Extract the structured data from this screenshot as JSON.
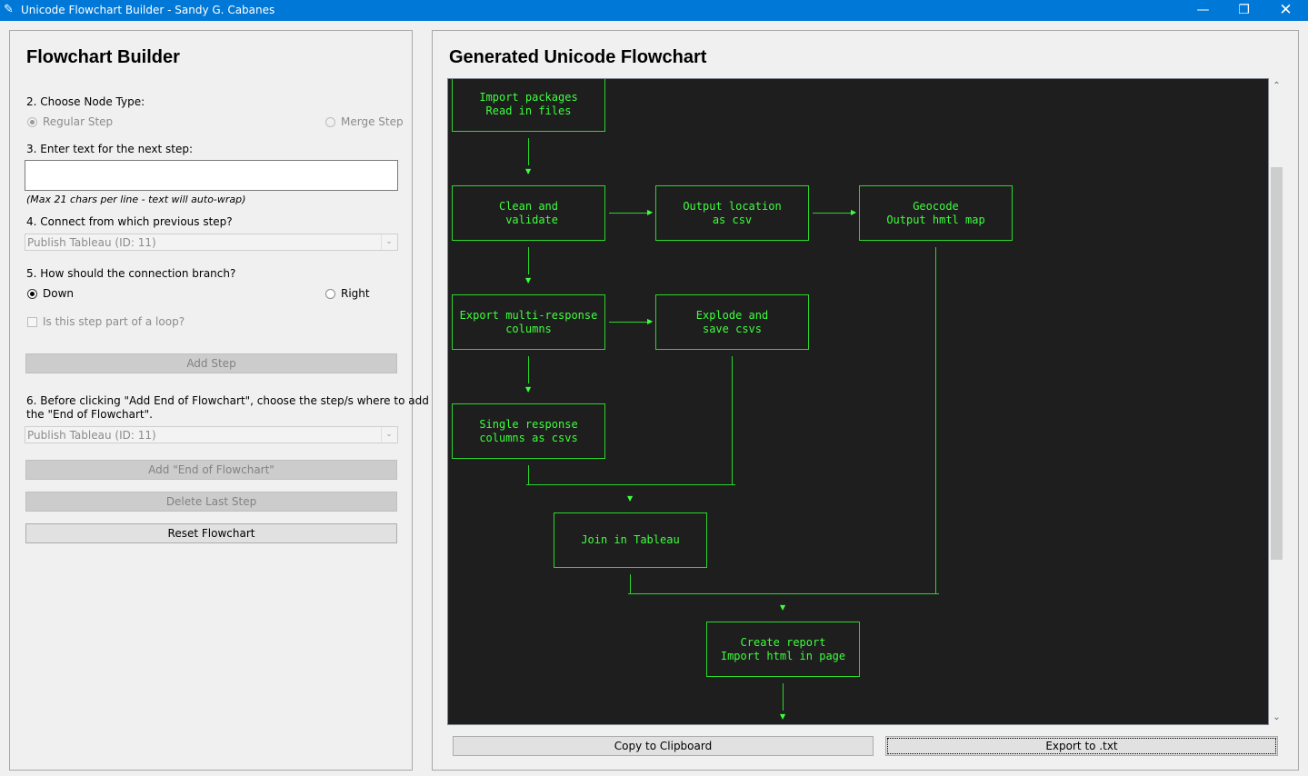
{
  "window": {
    "title": "Unicode Flowchart Builder - Sandy G. Cabanes"
  },
  "left": {
    "heading": "Flowchart Builder",
    "step2_label": "2. Choose Node Type:",
    "regular_label": "Regular Step",
    "merge_label": "Merge Step",
    "step3_label": "3. Enter text for the next step:",
    "text_value": "",
    "hint": "(Max 21 chars per line - text will auto-wrap)",
    "step4_label": "4. Connect from which previous step?",
    "connect_value": "Publish Tableau (ID: 11)",
    "step5_label": "5. How should the connection branch?",
    "down_label": "Down",
    "right_label": "Right",
    "loop_label": "Is this step part of a loop?",
    "add_step": "Add Step",
    "step6_label_line1": "6. Before clicking \"Add End of Flowchart\", choose the step/s where to add",
    "step6_label_line2": "the \"End of Flowchart\".",
    "end_value": "Publish Tableau (ID: 11)",
    "add_end": "Add \"End of Flowchart\"",
    "delete_last": "Delete Last Step",
    "reset": "Reset Flowchart"
  },
  "right": {
    "heading": "Generated Unicode Flowchart",
    "copy": "Copy to Clipboard",
    "export": "Export to .txt",
    "nodes": [
      [
        "Import packages",
        "Read in files"
      ],
      [
        "Clean and",
        " validate"
      ],
      [
        "Output location",
        "as csv"
      ],
      [
        "Geocode",
        "Output hmtl map"
      ],
      [
        "Export multi-response",
        "columns"
      ],
      [
        "Explode and",
        "save csvs"
      ],
      [
        "Single response",
        "columns as csvs"
      ],
      [
        "Join in Tableau"
      ],
      [
        "Create report",
        "Import html in page"
      ]
    ]
  },
  "colors": {
    "accent": "#0078d7",
    "flow": "#3dff3d",
    "canvas_bg": "#1e1e1e"
  }
}
